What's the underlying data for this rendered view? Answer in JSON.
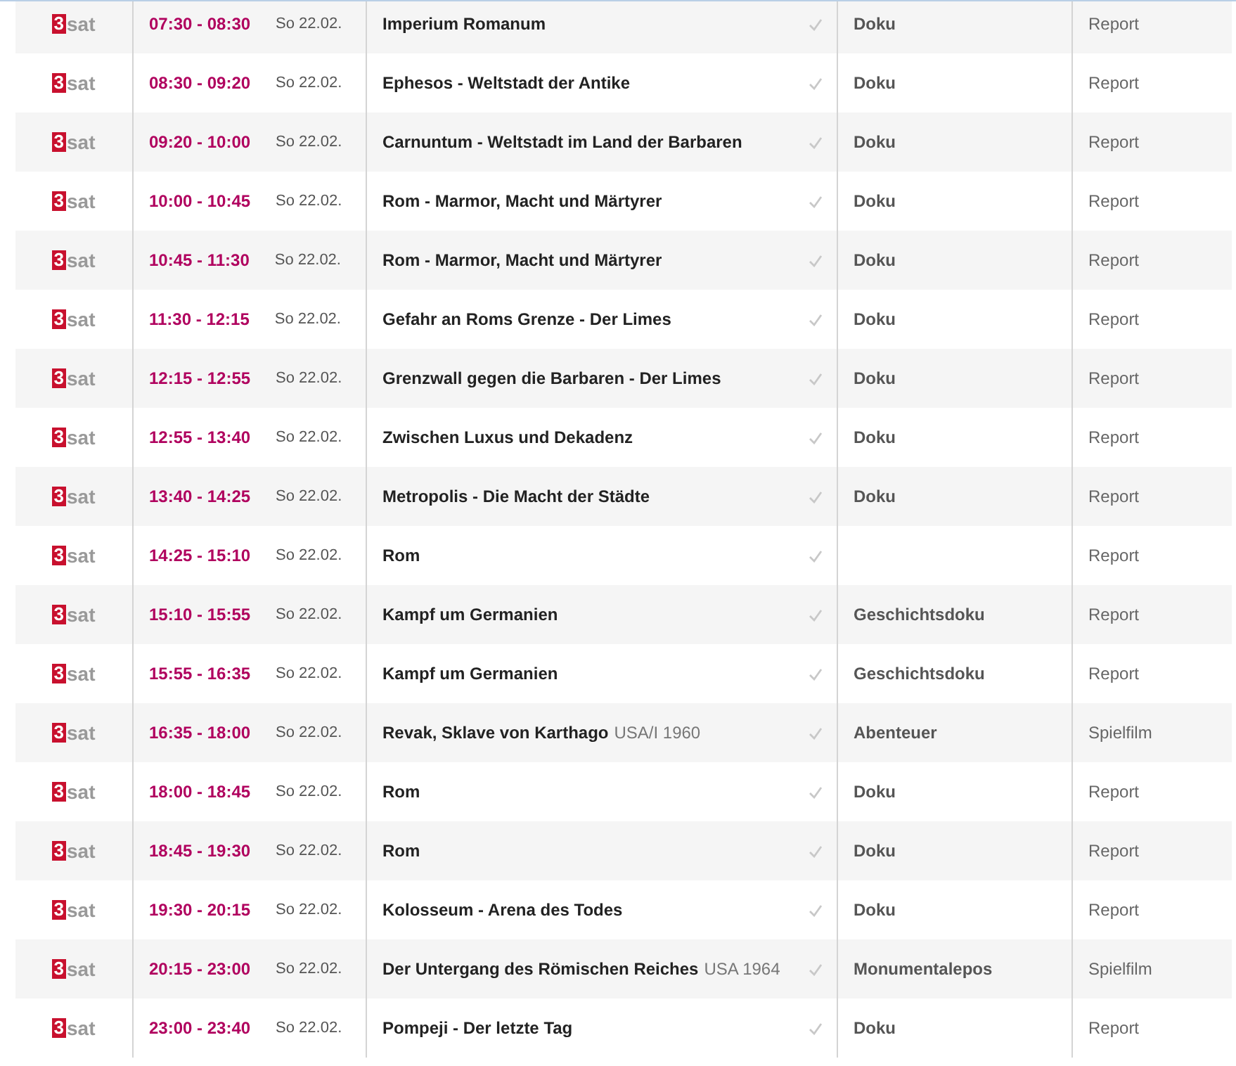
{
  "rows": [
    {
      "logo_mark": "3",
      "logo_text": "sat",
      "time": "07:30 - 08:30",
      "date": "So 22.02.",
      "title": "Imperium Romanum",
      "genre": "Doku",
      "category": "Report"
    },
    {
      "logo_mark": "3",
      "logo_text": "sat",
      "time": "08:30 - 09:20",
      "date": "So 22.02.",
      "title": "Ephesos - Weltstadt der Antike",
      "genre": "Doku",
      "category": "Report"
    },
    {
      "logo_mark": "3",
      "logo_text": "sat",
      "time": "09:20 - 10:00",
      "date": "So 22.02.",
      "title": "Carnuntum - Weltstadt im Land der Barbaren",
      "genre": "Doku",
      "category": "Report"
    },
    {
      "logo_mark": "3",
      "logo_text": "sat",
      "time": "10:00 - 10:45",
      "date": "So 22.02.",
      "title": "Rom - Marmor, Macht und Märtyrer",
      "genre": "Doku",
      "category": "Report"
    },
    {
      "logo_mark": "3",
      "logo_text": "sat",
      "time": "10:45 - 11:30",
      "date": "So 22.02.",
      "title": "Rom - Marmor, Macht und Märtyrer",
      "genre": "Doku",
      "category": "Report"
    },
    {
      "logo_mark": "3",
      "logo_text": "sat",
      "time": "11:30 - 12:15",
      "date": "So 22.02.",
      "title": "Gefahr an Roms Grenze - Der Limes",
      "genre": "Doku",
      "category": "Report"
    },
    {
      "logo_mark": "3",
      "logo_text": "sat",
      "time": "12:15 - 12:55",
      "date": "So 22.02.",
      "title": "Grenzwall gegen die Barbaren - Der Limes",
      "genre": "Doku",
      "category": "Report"
    },
    {
      "logo_mark": "3",
      "logo_text": "sat",
      "time": "12:55 - 13:40",
      "date": "So 22.02.",
      "title": "Zwischen Luxus und Dekadenz",
      "genre": "Doku",
      "category": "Report"
    },
    {
      "logo_mark": "3",
      "logo_text": "sat",
      "time": "13:40 - 14:25",
      "date": "So 22.02.",
      "title": "Metropolis - Die Macht der Städte",
      "genre": "Doku",
      "category": "Report"
    },
    {
      "logo_mark": "3",
      "logo_text": "sat",
      "time": "14:25 - 15:10",
      "date": "So 22.02.",
      "title": "Rom",
      "category": "Report"
    },
    {
      "logo_mark": "3",
      "logo_text": "sat",
      "time": "15:10 - 15:55",
      "date": "So 22.02.",
      "title": "Kampf um Germanien",
      "genre": "Geschichtsdoku",
      "category": "Report"
    },
    {
      "logo_mark": "3",
      "logo_text": "sat",
      "time": "15:55 - 16:35",
      "date": "So 22.02.",
      "title": "Kampf um Germanien",
      "genre": "Geschichtsdoku",
      "category": "Report"
    },
    {
      "logo_mark": "3",
      "logo_text": "sat",
      "time": "16:35 - 18:00",
      "date": "So 22.02.",
      "title": "Revak, Sklave von Karthago",
      "extra": "USA/I 1960",
      "genre": "Abenteuer",
      "category": "Spielfilm"
    },
    {
      "logo_mark": "3",
      "logo_text": "sat",
      "time": "18:00 - 18:45",
      "date": "So 22.02.",
      "title": "Rom",
      "genre": "Doku",
      "category": "Report"
    },
    {
      "logo_mark": "3",
      "logo_text": "sat",
      "time": "18:45 - 19:30",
      "date": "So 22.02.",
      "title": "Rom",
      "genre": "Doku",
      "category": "Report"
    },
    {
      "logo_mark": "3",
      "logo_text": "sat",
      "time": "19:30 - 20:15",
      "date": "So 22.02.",
      "title": "Kolosseum - Arena des Todes",
      "genre": "Doku",
      "category": "Report"
    },
    {
      "logo_mark": "3",
      "logo_text": "sat",
      "time": "20:15 - 23:00",
      "date": "So 22.02.",
      "title": "Der Untergang des Römischen Reiches",
      "extra": "USA 1964",
      "genre": "Monumentalepos",
      "category": "Spielfilm"
    },
    {
      "logo_mark": "3",
      "logo_text": "sat",
      "time": "23:00 - 23:40",
      "date": "So 22.02.",
      "title": "Pompeji - Der letzte Tag",
      "genre": "Doku",
      "category": "Report"
    }
  ]
}
